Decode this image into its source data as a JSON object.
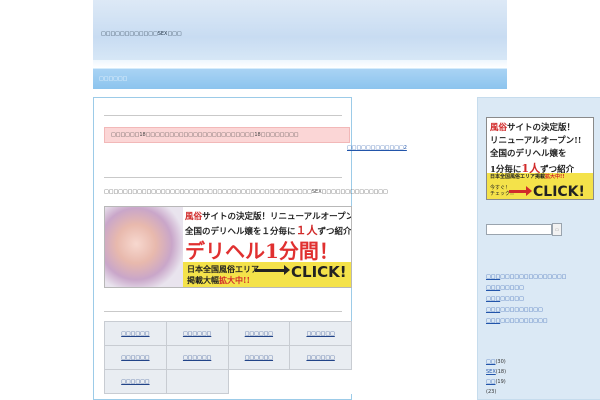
{
  "header": {
    "site_title": "□□□□□□□□□□□□SEX□□□"
  },
  "nav": {
    "home_link": "□□□□□□"
  },
  "notice": {
    "text": "□□□□□□18□□□□□□□□□□□□□□□□□□□□□□□18□□□□□□□□"
  },
  "side_note": "□□□□□□□□□□□□2",
  "intro": {
    "text": "□□□□□□□□□□□□□□□□□□□□□□□□□□□□□□□□□□□□□□□□□□□□SEX□□□□□□□□□□□□□□"
  },
  "banner": {
    "line1_red": "風俗",
    "line1": "サイトの決定版！リニューアルオープン!!",
    "line2_a": "全国のデリヘル嬢を１分毎に",
    "line2_red": "１人",
    "line2_b": "ずつ紹介",
    "line3": "デリヘル1分間！",
    "line4": "日本全国風俗エリア",
    "line5_a": "掲載大幅",
    "line5_red": "拡大中!!",
    "click": "CLICK!"
  },
  "grid": {
    "cells": [
      "□□□□□□",
      "□□□□□□",
      "□□□□□□",
      "□□□□□□",
      "□□□□□□",
      "□□□□□□",
      "□□□□□□",
      "□□□□□□",
      "□□□□□□"
    ]
  },
  "sidebar": {
    "banner": {
      "l1_red": "風俗",
      "l1": "サイトの決定版！",
      "l2": "リニューアルオープン!!",
      "l3": "全国のデリヘル嬢を",
      "l4_a": "1分毎に",
      "l4_red": "1人",
      "l4_b": "ずつ紹介",
      "band_a": "日本全国風俗エリア掲載",
      "band_red": "拡大中!!",
      "cta_small_1": "今すぐ！",
      "cta_small_2": "チェック!!",
      "click": "CLICK!"
    },
    "search": {
      "placeholder": "",
      "button": "□"
    },
    "categories": [
      {
        "link": "□□□",
        "rest": "□□□□□□□□□□□□□□"
      },
      {
        "link": "□□□",
        "rest": "□□□□□"
      },
      {
        "link": "□□□",
        "rest": "□□□□□"
      },
      {
        "link": "□□□",
        "rest": "□□□□□□□□□"
      },
      {
        "link": "□□□",
        "rest": "□□□□□□□□□□"
      }
    ],
    "tags": [
      {
        "link": "□□",
        "count": "(30)"
      },
      {
        "link": "SEX",
        "count": "(18)"
      },
      {
        "link": "□□",
        "count": "(19)"
      },
      {
        "link": "",
        "count": "(23)"
      }
    ]
  }
}
